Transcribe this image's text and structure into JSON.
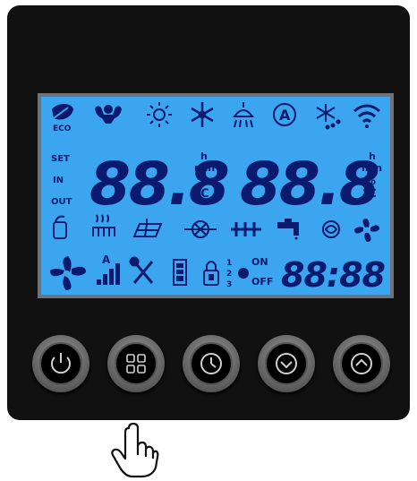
{
  "colors": {
    "panel": "#111111",
    "lcd_background": "#3ca5ef",
    "segment": "#0a1a6e",
    "button_ring": "#8a8a8a"
  },
  "lcd": {
    "set_label": "SET",
    "in_label": "IN",
    "out_label": "OUT",
    "eco_label": "ECO",
    "left_display": "88.8",
    "right_display": "88.8",
    "unit_h": "h",
    "unit_min": "min",
    "unit_percent": "%",
    "unit_celsius": "℃",
    "auto_label": "A",
    "signal_label": "A",
    "fan_speeds": [
      "1",
      "2",
      "3"
    ],
    "on_label": "ON",
    "off_label": "OFF",
    "clock_display": "88:88"
  },
  "buttons": [
    {
      "name": "power-button",
      "icon": "power-icon"
    },
    {
      "name": "mode-button",
      "icon": "grid-icon"
    },
    {
      "name": "timer-button",
      "icon": "clock-icon"
    },
    {
      "name": "down-button",
      "icon": "chevron-down-icon"
    },
    {
      "name": "up-button",
      "icon": "chevron-up-icon"
    }
  ],
  "pointer": {
    "icon": "pointing-hand-icon"
  }
}
